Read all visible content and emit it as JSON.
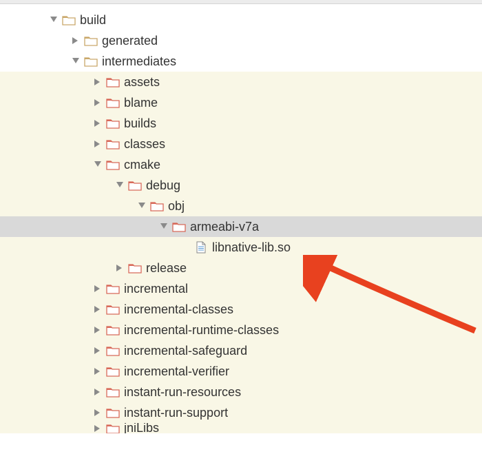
{
  "tree": {
    "build": {
      "label": "build",
      "expanded": true,
      "children": {
        "generated": {
          "label": "generated",
          "expanded": false
        },
        "intermediates": {
          "label": "intermediates",
          "expanded": true,
          "children": {
            "assets": {
              "label": "assets",
              "expanded": false
            },
            "blame": {
              "label": "blame",
              "expanded": false
            },
            "builds": {
              "label": "builds",
              "expanded": false
            },
            "classes": {
              "label": "classes",
              "expanded": false
            },
            "cmake": {
              "label": "cmake",
              "expanded": true,
              "children": {
                "debug": {
                  "label": "debug",
                  "expanded": true,
                  "children": {
                    "obj": {
                      "label": "obj",
                      "expanded": true,
                      "children": {
                        "armeabi_v7a": {
                          "label": "armeabi-v7a",
                          "expanded": true,
                          "selected": true,
                          "children": {
                            "libnative": {
                              "label": "libnative-lib.so",
                              "type": "file"
                            }
                          }
                        }
                      }
                    }
                  }
                },
                "release": {
                  "label": "release",
                  "expanded": false
                }
              }
            },
            "incremental": {
              "label": "incremental",
              "expanded": false
            },
            "incremental_classes": {
              "label": "incremental-classes",
              "expanded": false
            },
            "incremental_runtime_classes": {
              "label": "incremental-runtime-classes",
              "expanded": false
            },
            "incremental_safeguard": {
              "label": "incremental-safeguard",
              "expanded": false
            },
            "incremental_verifier": {
              "label": "incremental-verifier",
              "expanded": false
            },
            "instant_run_resources": {
              "label": "instant-run-resources",
              "expanded": false
            },
            "instant_run_support": {
              "label": "instant-run-support",
              "expanded": false
            },
            "jnilibs": {
              "label": "jniLibs",
              "expanded": false
            }
          }
        }
      }
    }
  }
}
